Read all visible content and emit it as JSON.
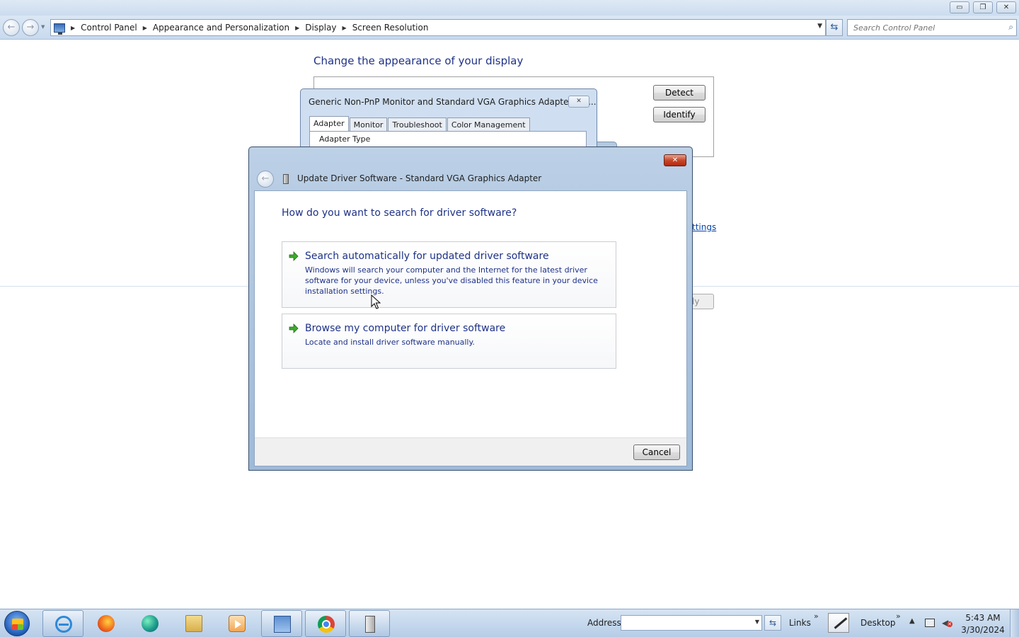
{
  "window": {
    "minimize_glyph": "▭",
    "restore_glyph": "❐",
    "close_glyph": "✕"
  },
  "nav": {
    "back_glyph": "←",
    "forward_glyph": "→",
    "breadcrumbs": [
      "Control Panel",
      "Appearance and Personalization",
      "Display",
      "Screen Resolution"
    ],
    "search_placeholder": "Search Control Panel"
  },
  "screen_resolution": {
    "title": "Change the appearance of your display",
    "detect_label": "Detect",
    "identify_label": "Identify",
    "advanced_link_partial": "ttings",
    "apply_partial": "ly"
  },
  "properties_dialog": {
    "title": "Generic Non-PnP Monitor and Standard VGA Graphics Adapter Pro...",
    "tabs": [
      {
        "label": "Adapter",
        "active": true
      },
      {
        "label": "Monitor",
        "active": false
      },
      {
        "label": "Troubleshoot",
        "active": false
      },
      {
        "label": "Color Management",
        "active": false
      }
    ],
    "group_label": "Adapter Type"
  },
  "driver_dialog": {
    "title": "Update Driver Software - Standard VGA Graphics Adapter",
    "question": "How do you want to search for driver software?",
    "options": [
      {
        "title": "Search automatically for updated driver software",
        "description": "Windows will search your computer and the Internet for the latest driver software for your device, unless you've disabled this feature in your device installation settings."
      },
      {
        "title": "Browse my computer for driver software",
        "description": "Locate and install driver software manually."
      }
    ],
    "cancel_label": "Cancel"
  },
  "taskbar": {
    "icons": [
      "internet-explorer-icon",
      "firefox-icon",
      "edge-icon",
      "file-explorer-icon",
      "media-player-icon",
      "control-panel-icon",
      "chrome-icon",
      "device-icon"
    ],
    "address_label": "Address",
    "links_label": "Links",
    "desktop_label": "Desktop",
    "chevron": "»",
    "time": "5:43 AM",
    "date": "3/30/2024"
  },
  "colors": {
    "link_blue": "#1e3287",
    "taskbar": "#c4d7ed",
    "dialog_frame": "#9dbad9"
  }
}
